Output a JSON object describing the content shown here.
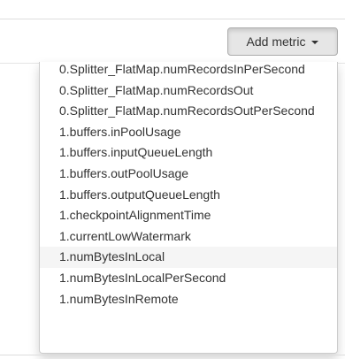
{
  "toolbar": {
    "add_metric_label": "Add metric"
  },
  "dropdown": {
    "hovered_index": 9,
    "items": [
      "0.Splitter_FlatMap.numRecordsInPerSecond",
      "0.Splitter_FlatMap.numRecordsOut",
      "0.Splitter_FlatMap.numRecordsOutPerSecond",
      "1.buffers.inPoolUsage",
      "1.buffers.inputQueueLength",
      "1.buffers.outPoolUsage",
      "1.buffers.outputQueueLength",
      "1.checkpointAlignmentTime",
      "1.currentLowWatermark",
      "1.numBytesInLocal",
      "1.numBytesInLocalPerSecond",
      "1.numBytesInRemote"
    ]
  }
}
